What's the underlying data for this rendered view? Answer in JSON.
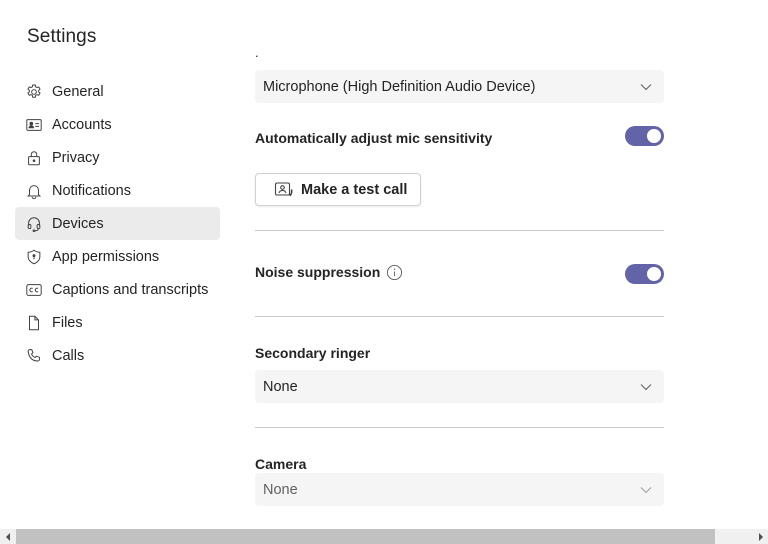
{
  "header": {
    "title": "Settings"
  },
  "sidebar": {
    "items": [
      {
        "label": "General",
        "icon": "gear-icon",
        "active": false
      },
      {
        "label": "Accounts",
        "icon": "id-card-icon",
        "active": false
      },
      {
        "label": "Privacy",
        "icon": "lock-icon",
        "active": false
      },
      {
        "label": "Notifications",
        "icon": "bell-icon",
        "active": false
      },
      {
        "label": "Devices",
        "icon": "headset-icon",
        "active": true
      },
      {
        "label": "App permissions",
        "icon": "shield-icon",
        "active": false
      },
      {
        "label": "Captions and transcripts",
        "icon": "closed-captions-icon",
        "active": false
      },
      {
        "label": "Files",
        "icon": "document-icon",
        "active": false
      },
      {
        "label": "Calls",
        "icon": "phone-icon",
        "active": false
      }
    ]
  },
  "devices": {
    "microphone": {
      "selected": "Microphone (High Definition Audio Device)"
    },
    "auto_mic": {
      "label": "Automatically adjust mic sensitivity",
      "enabled": true
    },
    "test_call": {
      "label": "Make a test call",
      "icon": "test-call-icon"
    },
    "noise_suppression": {
      "label": "Noise suppression",
      "enabled": true,
      "info_icon": "info-icon"
    },
    "secondary_ringer": {
      "label": "Secondary ringer",
      "selected": "None"
    },
    "camera": {
      "label": "Camera",
      "selected": "None"
    }
  },
  "colors": {
    "accent": "#6264a7",
    "active_nav_bg": "#ebebeb",
    "dropdown_bg": "#f5f5f5"
  }
}
